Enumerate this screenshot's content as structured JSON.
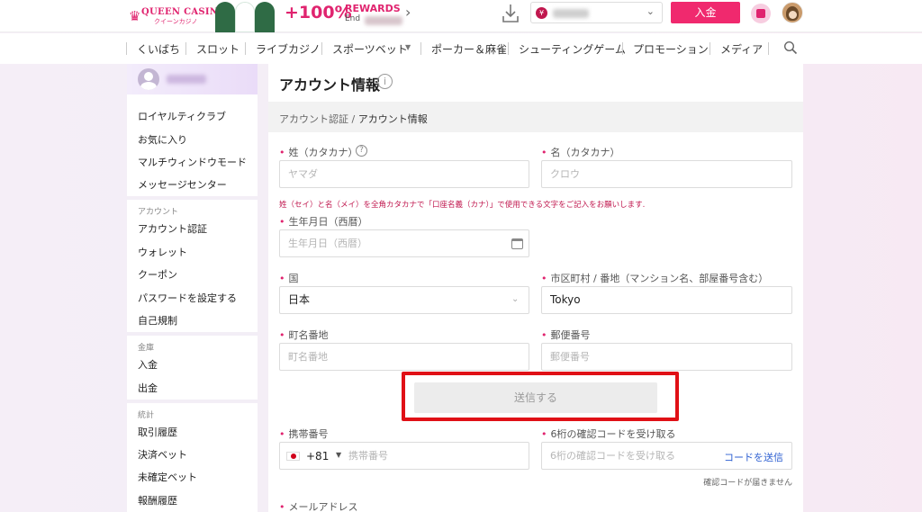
{
  "header": {
    "logo_text": "QUEEN CASINO",
    "logo_sub": "クイーンカジノ",
    "promo_percent": "+100%",
    "promo_rewards": "REWARDS",
    "promo_end": "End",
    "deposit_label": "入金",
    "currency_symbol": "¥",
    "accent_color": "#f0296e"
  },
  "nav": {
    "items": [
      "くいばち",
      "スロット",
      "ライブカジノ",
      "スポーツベット",
      "ポーカー＆麻雀",
      "シューティングゲーム",
      "プロモーション",
      "メディア"
    ]
  },
  "sidebar": {
    "items_top": [
      "ロイヤルティクラブ",
      "お気に入り",
      "マルチウィンドウモード",
      "メッセージセンター"
    ],
    "account_head": "アカウント",
    "account_items": [
      "アカウント認証",
      "ウォレット",
      "クーポン",
      "パスワードを設定する",
      "自己規制"
    ],
    "bank_head": "金庫",
    "bank_items": [
      "入金",
      "出金"
    ],
    "stats_head": "統計",
    "stats_items": [
      "取引履歴",
      "決済ベット",
      "未確定ベット",
      "報酬履歴"
    ]
  },
  "main": {
    "title": "アカウント情報",
    "breadcrumb_parent": "アカウント認証",
    "breadcrumb_sep": " / ",
    "breadcrumb_current": "アカウント情報",
    "last_name_label": "姓（カタカナ）",
    "last_name_placeholder": "ヤマダ",
    "first_name_label": "名（カタカナ）",
    "first_name_placeholder": "クロウ",
    "katakana_warning": "姓（セイ）と名（メイ）を全角カタカナで「口座名義（カナ）」で使用できる文字をご記入をお願いします.",
    "dob_label": "生年月日（西暦）",
    "dob_placeholder": "生年月日（西暦）",
    "country_label": "国",
    "country_value": "日本",
    "city_label": "市区町村 / 番地（マンション名、部屋番号含む）",
    "city_value": "Tokyo",
    "street_label": "町名番地",
    "street_placeholder": "町名番地",
    "zip_label": "郵便番号",
    "zip_placeholder": "郵便番号",
    "submit_label": "送信する",
    "phone_label": "携帯番号",
    "phone_country_code": "+81",
    "phone_placeholder": "携帯番号",
    "code_label": "6桁の確認コードを受け取る",
    "code_placeholder": "6桁の確認コードを受け取る",
    "send_code_label": "コードを送信",
    "no_code_text": "確認コードが届きません",
    "email_label": "メールアドレス",
    "required_mark": "•",
    "highlight_color": "#e01016"
  }
}
